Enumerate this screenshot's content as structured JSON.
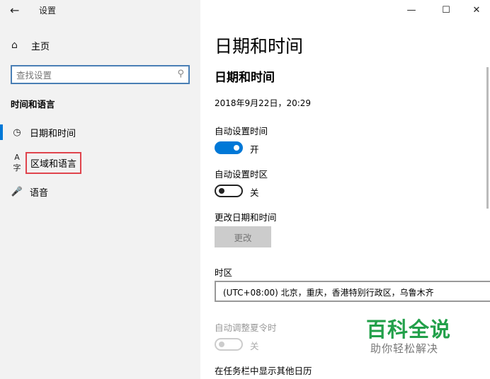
{
  "window": {
    "title": "设置",
    "back_icon": "back-arrow-icon",
    "controls": [
      "minimize-icon",
      "maximize-icon",
      "close-icon"
    ]
  },
  "sidebar": {
    "home_label": "主页",
    "search": {
      "placeholder": "查找设置"
    },
    "section_title": "时间和语言",
    "items": [
      {
        "label": "日期和时间",
        "icon": "calendar-clock-icon",
        "selected": true
      },
      {
        "label": "区域和语言",
        "icon": "language-icon",
        "highlighted": true
      },
      {
        "label": "语音",
        "icon": "microphone-icon"
      }
    ]
  },
  "main": {
    "page_title": "日期和时间",
    "sub_title": "日期和时间",
    "current_datetime": "2018年9月22日，20:29",
    "auto_time": {
      "label": "自动设置时间",
      "state": "开"
    },
    "auto_timezone": {
      "label": "自动设置时区",
      "state": "关"
    },
    "change_datetime": {
      "label": "更改日期和时间",
      "button": "更改"
    },
    "timezone": {
      "label": "时区",
      "value": "(UTC+08:00) 北京，重庆，香港特别行政区，乌鲁木齐"
    },
    "dst": {
      "label": "自动调整夏令时",
      "state": "关"
    },
    "calendar_label": "在任务栏中显示其他日历"
  },
  "watermark": {
    "title": "百科全说",
    "subtitle": "助你轻松解决"
  },
  "colors": {
    "accent": "#0078d7",
    "highlight_box": "#e0444d",
    "watermark": "#22a04a"
  }
}
